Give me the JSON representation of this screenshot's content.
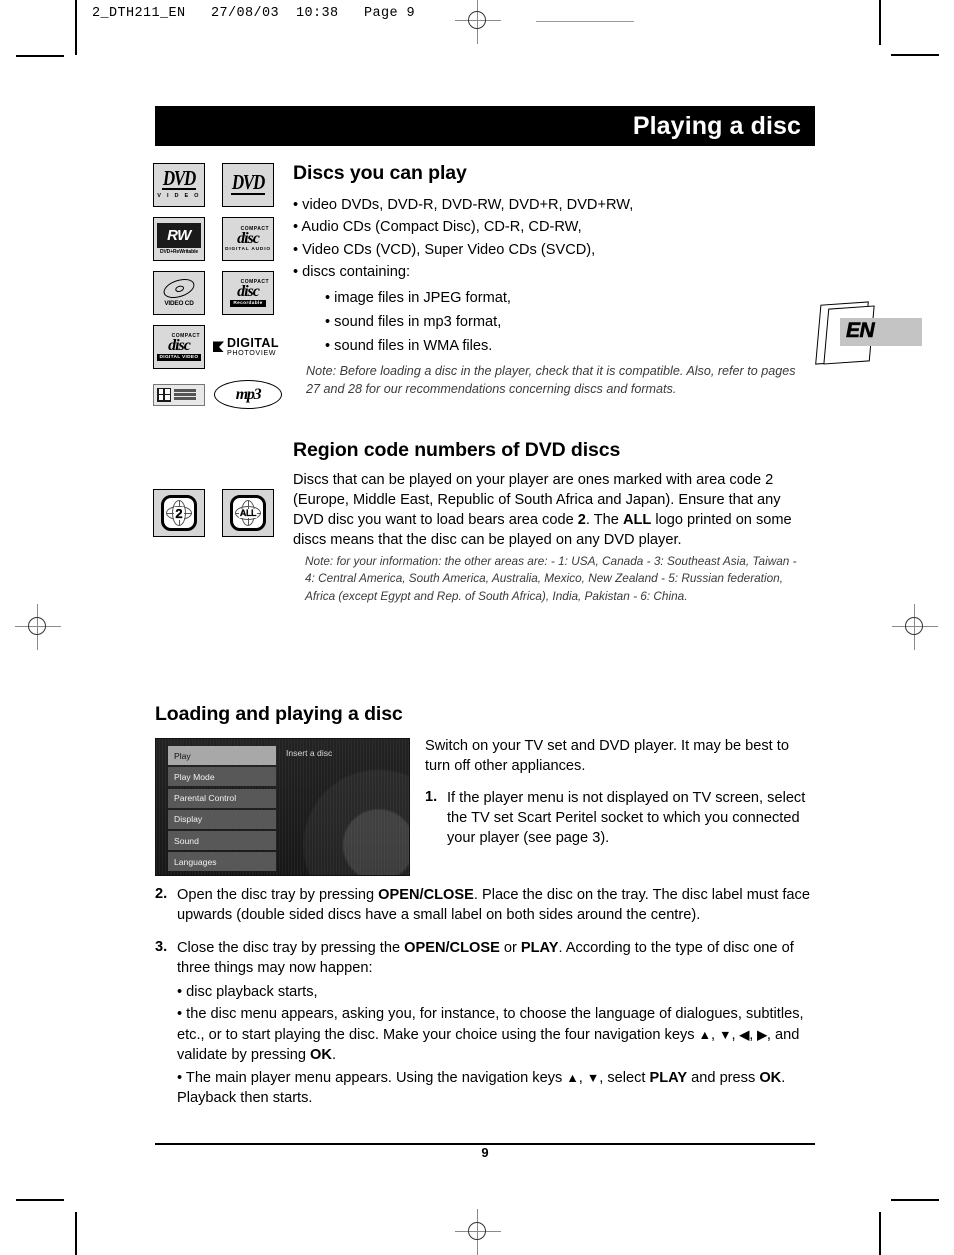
{
  "file_header": {
    "text": "2_DTH211_EN   27/08/03  10:38   Page 9"
  },
  "title_bar": {
    "title": "Playing a disc"
  },
  "language_tab": {
    "label": "EN"
  },
  "discs_section": {
    "heading": "Discs you can play",
    "bullets": [
      "• video DVDs, DVD-R, DVD-RW, DVD+R, DVD+RW,",
      "• Audio CDs (Compact Disc), CD-R, CD-RW,",
      "• Video CDs (VCD), Super Video CDs (SVCD),",
      "• discs containing:"
    ],
    "sub_bullets": [
      "• image files in JPEG format,",
      "• sound files in mp3 format,",
      "• sound files in WMA files."
    ],
    "note": "Note: Before loading a disc in the player, check that it is compatible. Also, refer to pages 27 and 28 for our recommendations concerning discs and formats."
  },
  "logos": {
    "dvd_video": {
      "main": "DVD",
      "sub": "V I D E O"
    },
    "dvd_plain": {
      "main": "DVD"
    },
    "dvd_rw": {
      "main": "RW",
      "sub": "DVD+ReWritable"
    },
    "cd_audio": {
      "top": "COMPACT",
      "main": "disc",
      "sub": "DIGITAL AUDIO"
    },
    "video_cd": {
      "sub": "VIDEO CD"
    },
    "cd_recordable": {
      "top": "COMPACT",
      "main": "disc",
      "sub": "Recordable"
    },
    "cd_digital_video": {
      "top": "COMPACT",
      "main": "disc",
      "sub": "DIGITAL VIDEO"
    },
    "digital_photoview": {
      "line1": "DIGITAL",
      "line2": "PHOTOVIEW",
      "tm": "™"
    },
    "windows_media": {
      "label": "Windows Media"
    },
    "mp3": {
      "label": "mp3"
    }
  },
  "region_section": {
    "heading": "Region code numbers of DVD discs",
    "body_1": "Discs that can be played on your player are ones marked with area code 2 (Europe, Middle East, Republic of South Africa and Japan). Ensure that any DVD disc you want to load bears area code ",
    "body_code": "2",
    "body_2": ". The ",
    "body_all": "ALL",
    "body_3": " logo printed on some discs means that the disc can be played on any DVD player.",
    "note": "Note: for your information: the other areas are: - 1: USA, Canada - 3: Southeast Asia, Taiwan - 4: Central America, South America, Australia, Mexico, New Zealand - 5: Russian federation, Africa (except Egypt and Rep. of South Africa), India, Pakistan - 6: China.",
    "logo_region": "2",
    "logo_all": "ALL"
  },
  "loading_section": {
    "heading": "Loading and playing a disc",
    "intro": "Switch on your TV set and DVD player. It may be best to turn off other appliances.",
    "step1_num": "1.",
    "step1_text": "If the player menu is not displayed on TV screen, select the TV set Scart Peritel socket to which you connected your player (see page 3).",
    "step2_num": "2.",
    "step2_a": "Open the disc tray by pressing ",
    "step2_b": "OPEN/CLOSE",
    "step2_c": ". Place the disc on the tray. The disc label must face upwards (double sided discs have a small label on both sides around the centre).",
    "step3_num": "3.",
    "step3_a": "Close the disc tray by pressing the ",
    "step3_b": "OPEN/CLOSE",
    "step3_c": " or ",
    "step3_d": "PLAY",
    "step3_e": ". According to the type of disc one of three things may now happen:",
    "outcome_1": "• disc playback starts,",
    "outcome_2_a": "• the disc menu appears, asking you, for instance, to choose the language of dialogues, subtitles, etc., or to start playing the disc. Make your choice using the four navigation keys ",
    "outcome_2_keys_1": "▲",
    "outcome_2_b": ", ",
    "outcome_2_keys_2": "▼",
    "outcome_2_c": ", ",
    "outcome_2_keys_3": "◀",
    "outcome_2_d": ", ",
    "outcome_2_keys_4": "▶",
    "outcome_2_e": ", and validate by pressing ",
    "outcome_2_ok": "OK",
    "outcome_2_f": ".",
    "outcome_3_a": "• The main player menu appears. Using the navigation keys ",
    "outcome_3_keys_1": "▲",
    "outcome_3_b": ", ",
    "outcome_3_keys_2": "▼",
    "outcome_3_c": ", select ",
    "outcome_3_play": "PLAY",
    "outcome_3_d": " and press ",
    "outcome_3_ok": "OK",
    "outcome_3_e": ". Playback then starts."
  },
  "tv_screen": {
    "insert_label": "Insert a disc",
    "menu_items": [
      {
        "label": "Play",
        "active": true
      },
      {
        "label": "Play Mode",
        "active": false
      },
      {
        "label": "Parental Control",
        "active": false
      },
      {
        "label": "Display",
        "active": false
      },
      {
        "label": "Sound",
        "active": false
      },
      {
        "label": "Languages",
        "active": false
      }
    ]
  },
  "footer": {
    "page_number": "9"
  }
}
